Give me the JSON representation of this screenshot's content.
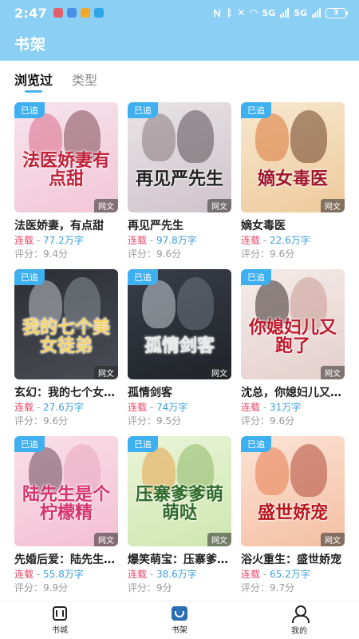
{
  "status_bar": {
    "time": "2:47",
    "network": "5G",
    "network2": "5G",
    "battery": "3",
    "notif_colors": [
      "#e35d6a",
      "#4a8ee8",
      "#f4a82b",
      "#2fa4e7"
    ]
  },
  "header": {
    "title": "书架"
  },
  "tabs": [
    {
      "label": "浏览过",
      "active": true
    },
    {
      "label": "类型",
      "active": false
    }
  ],
  "books": [
    {
      "title": "法医娇妻，有点甜",
      "cover_title": "法医娇妻有点甜",
      "badge": "已追",
      "genre": "网文",
      "status": "连载",
      "sep": " - ",
      "count": "77.2万字",
      "score": "评分：9.4分",
      "bg": [
        "#f6e4ec",
        "#f2c6d6"
      ],
      "fig": [
        "#d86b8c",
        "#7f4c5a"
      ],
      "title_color": "#c0223a"
    },
    {
      "title": "再见严先生",
      "cover_title": "再见严先生",
      "badge": "已追",
      "genre": "网文",
      "status": "连载",
      "sep": " - ",
      "count": "97.8万字",
      "score": "评分：9.6分",
      "bg": [
        "#e8e4e6",
        "#cfc3c9"
      ],
      "fig": [
        "#8a7a80",
        "#5a4e54"
      ],
      "title_color": "#222222"
    },
    {
      "title": "嫡女毒医",
      "cover_title": "嫡女毒医",
      "badge": "已追",
      "genre": "网文",
      "status": "连载",
      "sep": " - ",
      "count": "22.6万字",
      "score": "评分：9.6分",
      "bg": [
        "#f7e9d0",
        "#eec99a"
      ],
      "fig": [
        "#d9773a",
        "#6b3f26"
      ],
      "title_color": "#a0162a"
    },
    {
      "title": "玄幻：我的七个女徒弟",
      "cover_title": "我的七个美女徒弟",
      "badge": "已追",
      "genre": "网文",
      "status": "连载",
      "sep": " - ",
      "count": "27.6万字",
      "score": "评分：9.6分",
      "bg": [
        "#2c2e34",
        "#4a4d55"
      ],
      "fig": [
        "#bfc3c9",
        "#8a8f98"
      ],
      "title_color": "#f3d36a"
    },
    {
      "title": "孤情剑客",
      "cover_title": "孤情剑客",
      "badge": "已追",
      "genre": "网文",
      "status": "连载",
      "sep": " - ",
      "count": "74万字",
      "score": "评分：9.5分",
      "bg": [
        "#3a3e48",
        "#1f2228"
      ],
      "fig": [
        "#c9ccd3",
        "#6e7480"
      ],
      "title_color": "#e8e8e8"
    },
    {
      "title": "沈总，你媳妇儿又跑了",
      "cover_title": "你媳妇儿又跑了",
      "badge": "已追",
      "genre": "网文",
      "status": "连载",
      "sep": " - ",
      "count": "31万字",
      "score": "评分：9.6分",
      "bg": [
        "#f4ecea",
        "#e4cfcc"
      ],
      "fig": [
        "#3b2d2d",
        "#c89a92"
      ],
      "title_color": "#c01a2c"
    },
    {
      "title": "先婚后爱：陆先生是个柠檬精",
      "cover_title": "陆先生是个柠檬精",
      "badge": "已追",
      "genre": "网文",
      "status": "连载",
      "sep": " - ",
      "count": "55.8万字",
      "score": "评分：9.9分",
      "bg": [
        "#f9dfe8",
        "#f3bfd2"
      ],
      "fig": [
        "#6a4a5a",
        "#e9a8bf"
      ],
      "title_color": "#d6336c"
    },
    {
      "title": "爆笑萌宝：压寨爹爹萌萌哒",
      "cover_title": "压寨爹爹萌萌哒",
      "badge": "已追",
      "genre": "网文",
      "status": "连载",
      "sep": " - ",
      "count": "38.6万字",
      "score": "评分：9分",
      "bg": [
        "#eaf4d8",
        "#cfe6b0"
      ],
      "fig": [
        "#e6a24a",
        "#8fb86a"
      ],
      "title_color": "#2f6a2a"
    },
    {
      "title": "浴火重生：盛世娇宠",
      "cover_title": "盛世娇宠",
      "badge": "已追",
      "genre": "网文",
      "status": "连载",
      "sep": " - ",
      "count": "65.2万字",
      "score": "评分：9.7分",
      "bg": [
        "#fbe3d6",
        "#f4bfa2"
      ],
      "fig": [
        "#e77b4f",
        "#b14a3a"
      ],
      "title_color": "#b8161e"
    }
  ],
  "bottom_nav": [
    {
      "label": "书城",
      "icon": "book-store-icon",
      "active": false
    },
    {
      "label": "书架",
      "icon": "bookshelf-icon",
      "active": true
    },
    {
      "label": "我的",
      "icon": "profile-icon",
      "active": false
    }
  ]
}
